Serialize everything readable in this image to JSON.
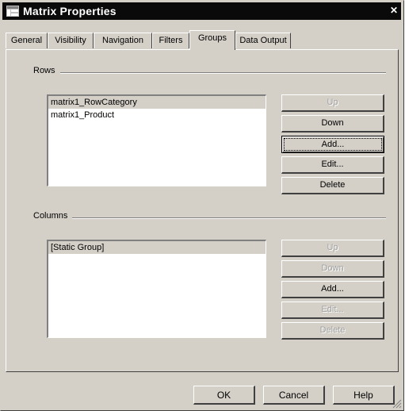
{
  "window": {
    "title": "Matrix Properties",
    "close_glyph": "✕",
    "icon": "matrix-app-icon"
  },
  "tabs": [
    {
      "label": "General",
      "active": false
    },
    {
      "label": "Visibility",
      "active": false
    },
    {
      "label": "Navigation",
      "active": false
    },
    {
      "label": "Filters",
      "active": false
    },
    {
      "label": "Groups",
      "active": true
    },
    {
      "label": "Data Output",
      "active": false
    }
  ],
  "rows": {
    "label": "Rows",
    "items": [
      "matrix1_RowCategory",
      "matrix1_Product"
    ],
    "buttons": {
      "up": "Up",
      "down": "Down",
      "add": "Add...",
      "edit": "Edit...",
      "delete": "Delete"
    }
  },
  "columns": {
    "label": "Columns",
    "items": [
      "[Static Group]"
    ],
    "buttons": {
      "up": "Up",
      "down": "Down",
      "add": "Add...",
      "edit": "Edit...",
      "delete": "Delete"
    }
  },
  "footer": {
    "ok": "OK",
    "cancel": "Cancel",
    "help": "Help"
  },
  "colors": {
    "face": "#d4d0c8",
    "titlebar": "#0a0a0a",
    "disabled_text": "#a0a0a0"
  }
}
